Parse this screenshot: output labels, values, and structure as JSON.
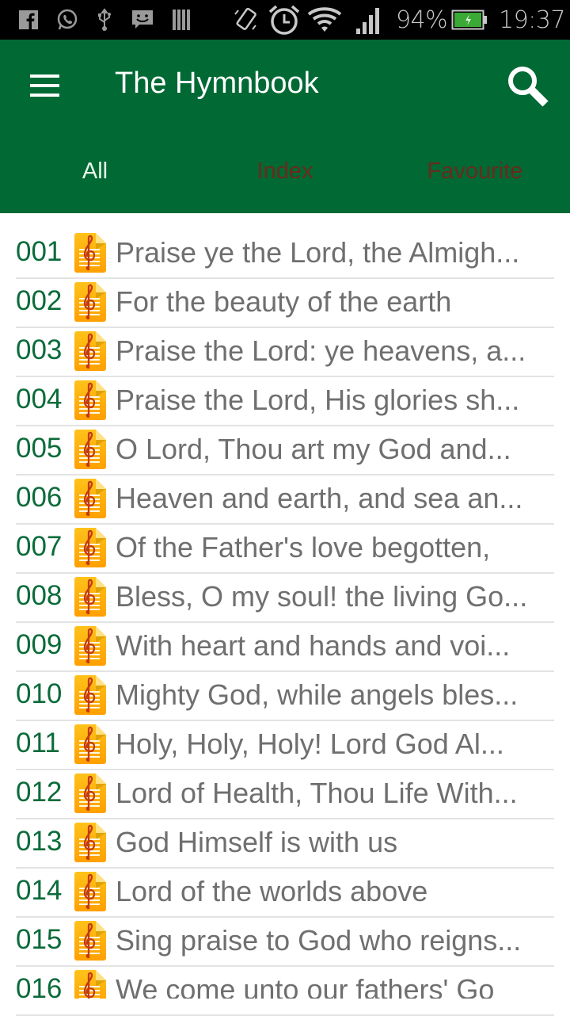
{
  "statusbar": {
    "left_icons": [
      "facebook-icon",
      "whatsapp-icon",
      "usb-icon",
      "message-icon",
      "barcode-icon"
    ],
    "right_icons": [
      "screen-rotate-icon",
      "alarm-icon",
      "wifi-icon",
      "signal-icon"
    ],
    "battery_percent": "94%",
    "battery_level": 0.94,
    "battery_charging": true,
    "time": "19:37",
    "battery_color": "#3aa935"
  },
  "appbar": {
    "title": "The Hymnbook",
    "menu_icon": "hamburger-menu-icon",
    "search_icon": "search-icon",
    "background": "#006934"
  },
  "tabs": [
    {
      "label": "All",
      "active": true
    },
    {
      "label": "Index",
      "active": false
    },
    {
      "label": "Favourite",
      "active": false
    }
  ],
  "hymns": [
    {
      "number": "001",
      "title": "Praise ye the Lord, the Almigh..."
    },
    {
      "number": "002",
      "title": "For the beauty of the earth"
    },
    {
      "number": "003",
      "title": "Praise the Lord: ye heavens, a..."
    },
    {
      "number": "004",
      "title": "Praise the Lord, His glories sh..."
    },
    {
      "number": "005",
      "title": "O Lord, Thou art my God and..."
    },
    {
      "number": "006",
      "title": "Heaven and earth, and sea an..."
    },
    {
      "number": "007",
      "title": "Of the Father's love begotten,"
    },
    {
      "number": "008",
      "title": "Bless, O my soul! the living Go..."
    },
    {
      "number": "009",
      "title": "With heart and hands and voi..."
    },
    {
      "number": "010",
      "title": "Mighty God, while angels bles..."
    },
    {
      "number": "011",
      "title": "Holy, Holy, Holy! Lord God Al..."
    },
    {
      "number": "012",
      "title": "Lord of Health, Thou Life With..."
    },
    {
      "number": "013",
      "title": "God Himself is with us"
    },
    {
      "number": "014",
      "title": "Lord of the worlds above"
    },
    {
      "number": "015",
      "title": "Sing praise to God who reigns..."
    },
    {
      "number": "016",
      "title": "We come unto our fathers' Go"
    }
  ],
  "hymn_icon": "music-sheet-icon"
}
